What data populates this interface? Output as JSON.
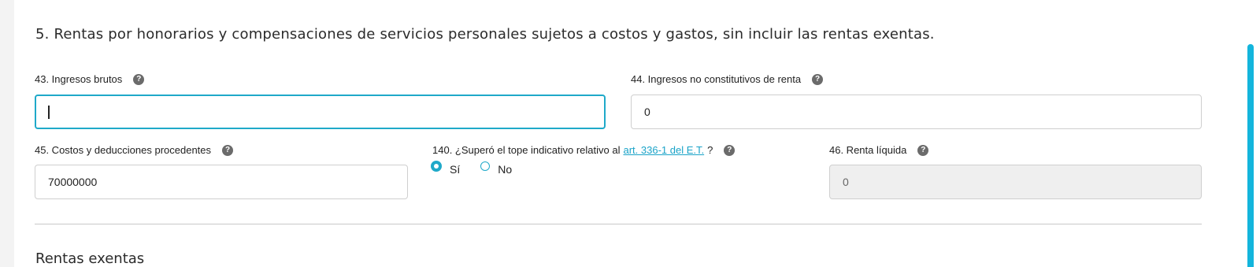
{
  "section": {
    "title": "5. Rentas por honorarios y compensaciones de servicios personales sujetos a costos y gastos, sin incluir las rentas exentas."
  },
  "fields": {
    "f43": {
      "label": "43. Ingresos brutos",
      "value": ""
    },
    "f44": {
      "label": "44. Ingresos no constitutivos de renta",
      "value": "0"
    },
    "f45": {
      "label": "45. Costos y deducciones procedentes",
      "value": "70000000"
    },
    "f140": {
      "label_prefix": "140. ¿Superó el tope indicativo relativo al",
      "link": "art. 336-1 del E.T.",
      "label_suffix": "?",
      "options": [
        "Sí",
        "No"
      ],
      "selected": "Sí"
    },
    "f46": {
      "label": "46. Renta líquida",
      "value": "0"
    }
  },
  "help_icon": "?",
  "next_section": {
    "title": "Rentas exentas"
  },
  "colors": {
    "accent": "#1fa9c9",
    "scrollbar": "#13b5dc"
  }
}
